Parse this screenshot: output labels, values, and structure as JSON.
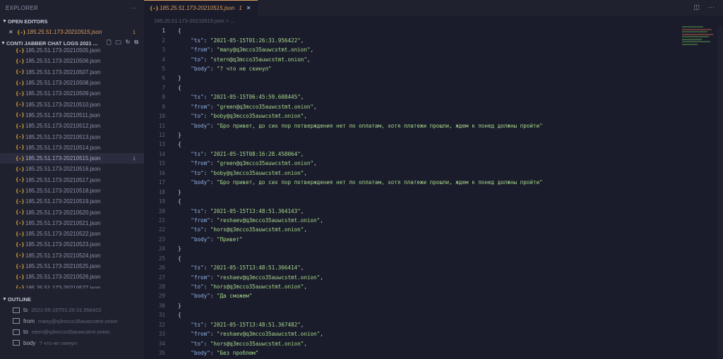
{
  "sidebar": {
    "header": "EXPLORER",
    "more_icon": "ellipsis-icon",
    "open_editors_title": "OPEN EDITORS",
    "open_editor": {
      "name": "185.25.51.173-20210515.json",
      "badge": "1"
    },
    "folder_title": "CONTI JABBER CHAT LOGS 2021 ...",
    "files": [
      {
        "name": "185.25.51.173-20210505.json",
        "badge": ""
      },
      {
        "name": "185.25.51.173-20210506.json",
        "badge": ""
      },
      {
        "name": "185.25.51.173-20210507.json",
        "badge": ""
      },
      {
        "name": "185.25.51.173-20210508.json",
        "badge": ""
      },
      {
        "name": "185.25.51.173-20210509.json",
        "badge": ""
      },
      {
        "name": "185.25.51.173-20210510.json",
        "badge": ""
      },
      {
        "name": "185.25.51.173-20210511.json",
        "badge": ""
      },
      {
        "name": "185.25.51.173-20210512.json",
        "badge": ""
      },
      {
        "name": "185.25.51.173-20210513.json",
        "badge": ""
      },
      {
        "name": "185.25.51.173-20210514.json",
        "badge": ""
      },
      {
        "name": "185.25.51.173-20210515.json",
        "badge": "1",
        "active": true
      },
      {
        "name": "185.25.51.173-20210516.json",
        "badge": ""
      },
      {
        "name": "185.25.51.173-20210517.json",
        "badge": ""
      },
      {
        "name": "185.25.51.173-20210518.json",
        "badge": ""
      },
      {
        "name": "185.25.51.173-20210519.json",
        "badge": ""
      },
      {
        "name": "185.25.51.173-20210520.json",
        "badge": ""
      },
      {
        "name": "185.25.51.173-20210521.json",
        "badge": ""
      },
      {
        "name": "185.25.51.173-20210522.json",
        "badge": ""
      },
      {
        "name": "185.25.51.173-20210523.json",
        "badge": ""
      },
      {
        "name": "185.25.51.173-20210524.json",
        "badge": ""
      },
      {
        "name": "185.25.51.173-20210525.json",
        "badge": ""
      },
      {
        "name": "185.25.51.173-20210526.json",
        "badge": ""
      },
      {
        "name": "185.25.51.173-20210527.json",
        "badge": ""
      }
    ],
    "outline_title": "OUTLINE",
    "outline": [
      {
        "key": "ts",
        "value": "2021-05-15T01:26:31.956422"
      },
      {
        "key": "from",
        "value": "many@q3mcco35auwcstmt.onion"
      },
      {
        "key": "to",
        "value": "stern@q3mcco35auwcstmt.onion"
      },
      {
        "key": "body",
        "value": "? что не скинул"
      }
    ]
  },
  "editor": {
    "tab": {
      "name": "185.25.51.173-20210515.json",
      "badge": "1"
    },
    "breadcrumb": "185.25.51.173-20210515.json > ...",
    "actions": [
      "split-editor-icon",
      "ellipsis-icon"
    ],
    "records": [
      {
        "ts": "2021-05-15T01:26:31.956422",
        "from": "many@q3mcco35auwcstmt.onion",
        "to": "stern@q3mcco35auwcstmt.onion",
        "body": "? что не скинул"
      },
      {
        "ts": "2021-05-15T06:45:59.608445",
        "from": "green@q3mcco35auwcstmt.onion",
        "to": "boby@q3mcco35auwcstmt.onion",
        "body": "Бро привет, до сих пор потверждения нет по оплатам, хотя платежи прошли, ждем к понед должны пройти"
      },
      {
        "ts": "2021-05-15T08:16:28.458064",
        "from": "green@q3mcco35auwcstmt.onion",
        "to": "boby@q3mcco35auwcstmt.onion",
        "body": "Бро привет, до сих пор потверждения нет по оплатам, хотя платежи прошли, ждем к понед должны пройти"
      },
      {
        "ts": "2021-05-15T13:48:51.364143",
        "from": "reshaev@q3mcco35auwcstmt.onion",
        "to": "hors@q3mcco35auwcstmt.onion",
        "body": "Привет"
      },
      {
        "ts": "2021-05-15T13:48:51.366414",
        "from": "reshaev@q3mcco35auwcstmt.onion",
        "to": "hors@q3mcco35auwcstmt.onion",
        "body": "Да сможем"
      },
      {
        "ts": "2021-05-15T13:48:51.367482",
        "from": "reshaev@q3mcco35auwcstmt.onion",
        "to": "hors@q3mcco35auwcstmt.onion",
        "body": "Без проблем"
      }
    ],
    "last_line_number": 37
  },
  "colors": {
    "key": "#8fb4e8",
    "string": "#a6d88a",
    "accent": "#d99c5e",
    "json_icon": "#e6b33c"
  }
}
